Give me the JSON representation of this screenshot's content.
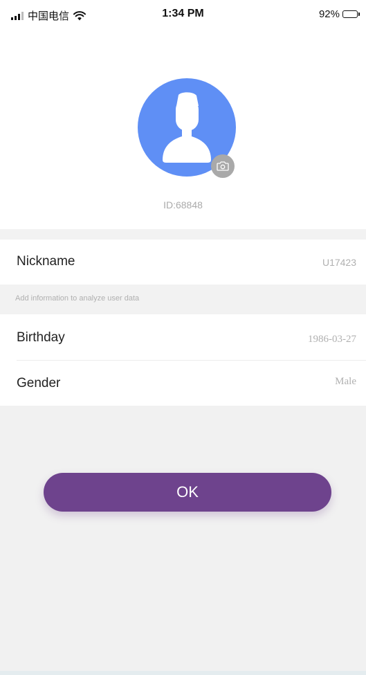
{
  "status_bar": {
    "carrier": "中国电信",
    "time": "1:34 PM",
    "battery_percent": "92%",
    "battery_level": 0.92,
    "icons": [
      "signal-icon",
      "wifi-icon",
      "battery-icon"
    ]
  },
  "profile": {
    "avatar_icon": "user-silhouette-icon",
    "avatar_color": "#5f8ff5",
    "camera_icon": "camera-icon",
    "user_id": "ID:68848"
  },
  "fields": {
    "nickname": {
      "label": "Nickname",
      "value": "U17423"
    },
    "hint": "Add information to analyze user data",
    "birthday": {
      "label": "Birthday",
      "value": "1986-03-27"
    },
    "gender": {
      "label": "Gender",
      "value": "Male"
    }
  },
  "actions": {
    "ok_label": "OK",
    "ok_color": "#6e438d"
  }
}
